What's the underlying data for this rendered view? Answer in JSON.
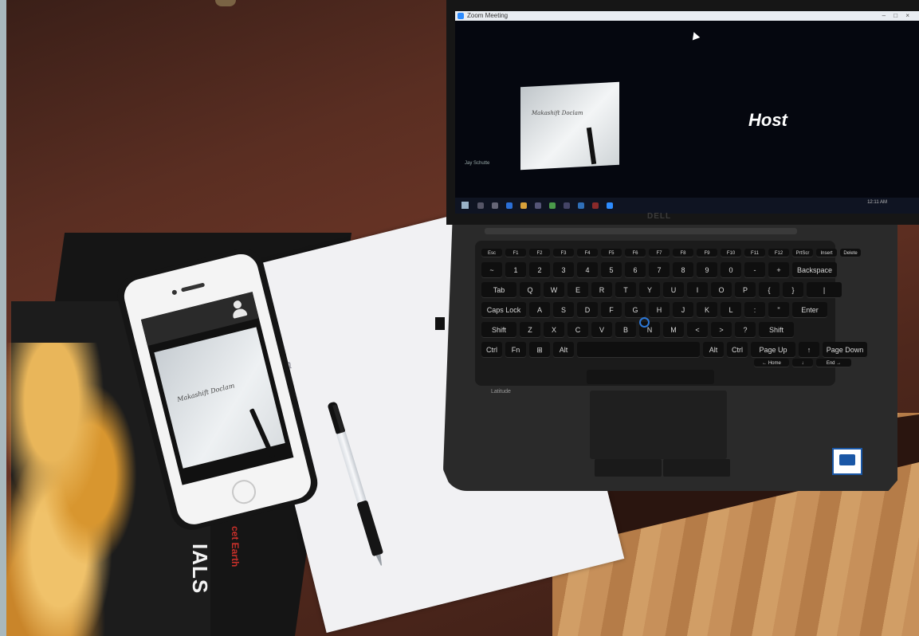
{
  "zoom": {
    "window_title": "Zoom Meeting",
    "host_label": "Host",
    "tile_caption": "Makashift Doclam",
    "participant_name": "Jay Schutte",
    "taskbar_time": "12:11 AM"
  },
  "phone": {
    "caption": "Makashift Doclam"
  },
  "paper": {
    "writing": "clam"
  },
  "book": {
    "spine_title": "IALS",
    "spine_red": "cet Earth"
  },
  "laptop": {
    "brand": "DELL",
    "model": "Latitude",
    "keyboard": {
      "row_fn": [
        "Esc",
        "F1",
        "F2",
        "F3",
        "F4",
        "F5",
        "F6",
        "F7",
        "F8",
        "F9",
        "F10",
        "F11",
        "F12",
        "PrtScr",
        "Insert",
        "Delete"
      ],
      "row_num": [
        "~",
        "1",
        "2",
        "3",
        "4",
        "5",
        "6",
        "7",
        "8",
        "9",
        "0",
        "-",
        "+",
        "Backspace"
      ],
      "row_q": [
        "Tab",
        "Q",
        "W",
        "E",
        "R",
        "T",
        "Y",
        "U",
        "I",
        "O",
        "P",
        "{",
        "}",
        "|"
      ],
      "row_a": [
        "Caps Lock",
        "A",
        "S",
        "D",
        "F",
        "G",
        "H",
        "J",
        "K",
        "L",
        ":",
        "\"",
        "Enter"
      ],
      "row_z": [
        "Shift",
        "Z",
        "X",
        "C",
        "V",
        "B",
        "N",
        "M",
        "<",
        ">",
        "?",
        "Shift"
      ],
      "row_bottom": [
        "Ctrl",
        "Fn",
        "⊞",
        "Alt",
        "",
        "Alt",
        "Ctrl",
        "Page Up",
        "↑",
        "Page Down"
      ],
      "row_arrows": [
        "← Home",
        "↓",
        "End →"
      ]
    }
  },
  "colors": {
    "zoom_blue": "#2d8cff",
    "trackpoint": "#2c78d8",
    "intel_blue": "#1a57a6"
  }
}
